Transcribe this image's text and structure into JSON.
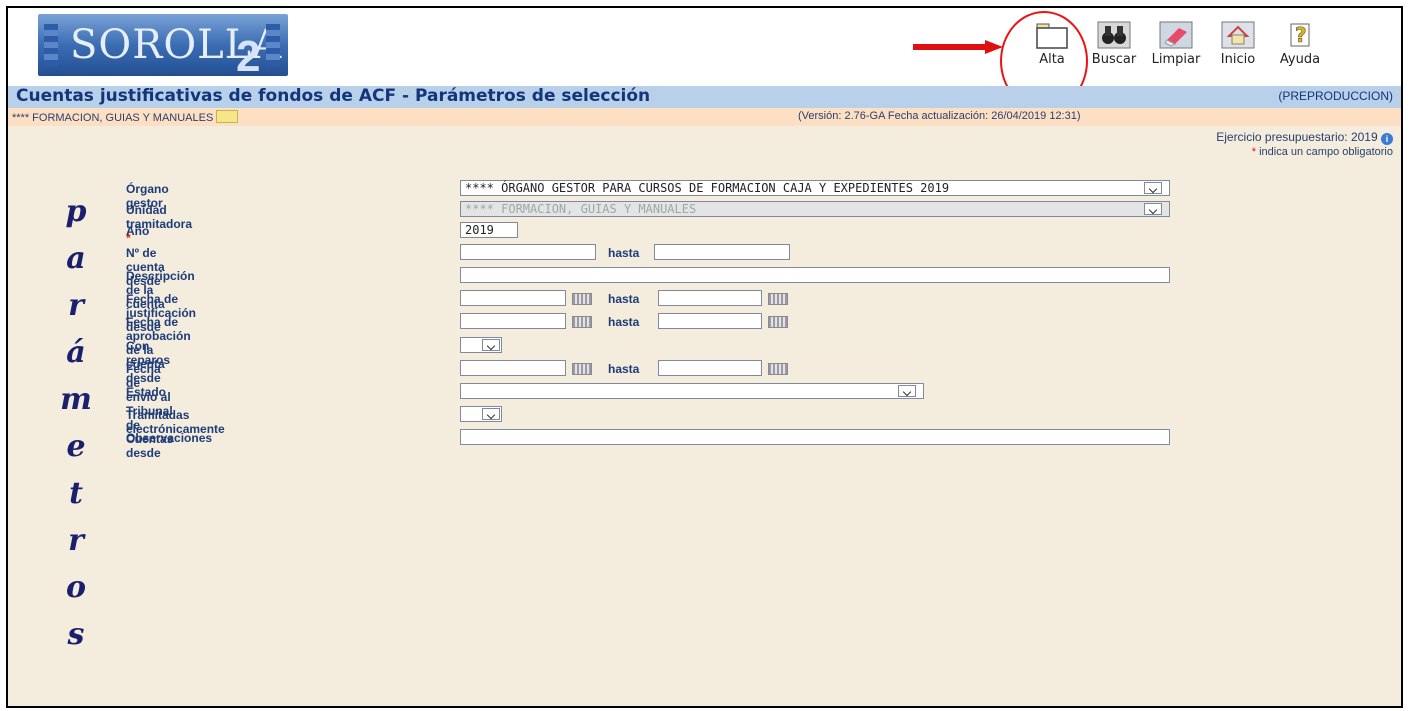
{
  "header": {
    "logo_text": "SOROLLA",
    "logo_number": "2",
    "toolbar": [
      {
        "label": "Alta",
        "icon": "folder-icon"
      },
      {
        "label": "Buscar",
        "icon": "binoculars-icon"
      },
      {
        "label": "Limpiar",
        "icon": "eraser-icon"
      },
      {
        "label": "Inicio",
        "icon": "home-icon"
      },
      {
        "label": "Ayuda",
        "icon": "help-icon"
      }
    ]
  },
  "title": "Cuentas justificativas de fondos de ACF - Parámetros de selección",
  "environment": "(PREPRODUCCION)",
  "unit": "**** FORMACION, GUIAS Y MANUALES",
  "version": "(Versión: 2.76-GA Fecha actualización: 26/04/2019 12:31)",
  "ejercicio": "Ejercicio presupuestario: 2019",
  "required_note": "indica un campo obligatorio",
  "vertical_word": [
    "p",
    "a",
    "r",
    "á",
    "m",
    "e",
    "t",
    "r",
    "o",
    "s"
  ],
  "form": {
    "organo_label": "Órgano gestor",
    "organo_value": "**** ÓRGANO GESTOR PARA CURSOS DE FORMACION CAJA Y EXPEDIENTES 2019",
    "unidad_label": "Unidad tramitadora",
    "unidad_value": "**** FORMACION, GUIAS Y MANUALES",
    "anio_label": "Año",
    "anio_value": "2019",
    "cuenta_label": "Nº de cuenta desde",
    "hasta_label": "hasta",
    "descripcion_label": "Descripción de la cuenta",
    "fecha_just_label": "Fecha de justificación desde",
    "fecha_aprob_label": "Fecha de aprobación de la cuenta desde",
    "reparos_label": "Con reparos",
    "fecha_envio_label": "Fecha de envío al Tribunal de Cuentas desde",
    "estado_label": "Estado",
    "tramitadas_label": "Tramitadas electrónicamente",
    "observaciones_label": "Observaciones"
  }
}
